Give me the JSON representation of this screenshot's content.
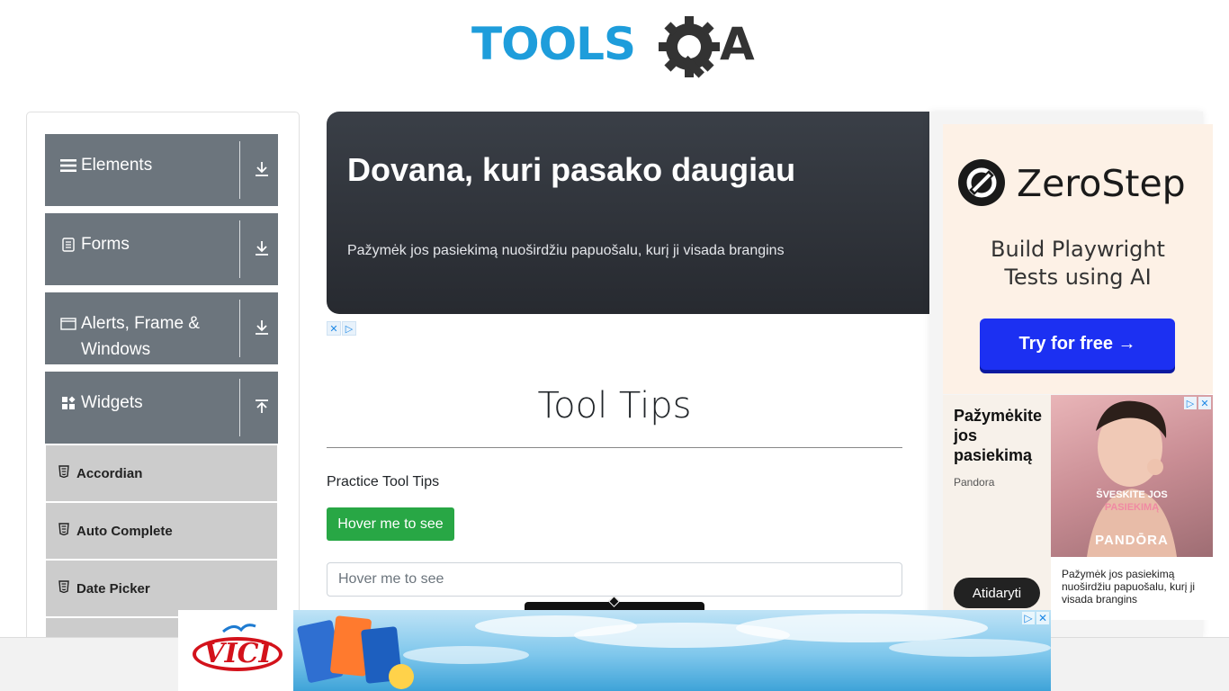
{
  "header": {
    "logo_text": "TOOLSQA"
  },
  "sidebar": {
    "groups": [
      {
        "label": "Elements",
        "icon": "hamburger-icon"
      },
      {
        "label": "Forms",
        "icon": "document-icon"
      },
      {
        "label": "Alerts, Frame & Windows",
        "icon": "window-icon"
      },
      {
        "label": "Widgets",
        "icon": "widgets-icon"
      }
    ],
    "widget_items": [
      {
        "label": "Accordian"
      },
      {
        "label": "Auto Complete"
      },
      {
        "label": "Date Picker"
      }
    ]
  },
  "banner_ad": {
    "title": "Dovana, kuri pasako daugiau",
    "text": "Pažymėk jos pasiekimą nuoširdžiu papuošalu, kurį ji visada brangins"
  },
  "main": {
    "title": "Tool Tips",
    "practice_label": "Practice Tool Tips",
    "hover_button_label": "Hover me to see",
    "hover_input_placeholder": "Hover me to see"
  },
  "right_ads": {
    "zerostep": {
      "name": "ZeroStep",
      "tagline": "Build Playwright Tests using AI",
      "button": "Try for free →"
    },
    "pandora": {
      "title": "Pažymėkite jos pasiekimą",
      "brand": "Pandora",
      "button": "Atidaryti",
      "image_line1": "ŠVESKITE JOS",
      "image_line2": "PASIEKIMĄ",
      "image_brand": "PANDŌRA",
      "description": "Pažymėk jos pasiekimą nuoširdžiu papuošalu, kurį ji visada brangins"
    }
  },
  "bottom_ad": {
    "brand": "VICI"
  },
  "colors": {
    "logo_blue": "#1e9ddb",
    "logo_dark": "#333333",
    "sidebar_group": "#6c757d",
    "sidebar_item": "#cccccc",
    "primary_green": "#28a745",
    "zerostep_blue": "#1c30f2",
    "vici_red": "#d3121b"
  }
}
